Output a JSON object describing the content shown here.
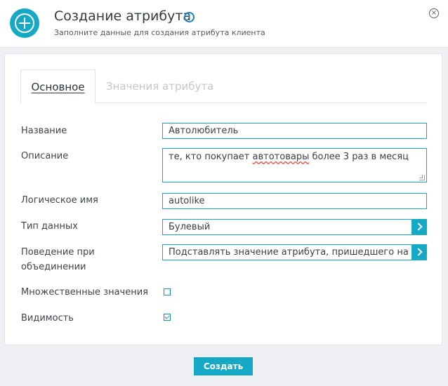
{
  "header": {
    "title": "Создание атрибута",
    "info_icon": "info-icon",
    "info_glyph": "!",
    "subtitle": "Заполните данные для создания атрибута клиента",
    "close_glyph": "×"
  },
  "tabs": [
    {
      "label": "Основное",
      "active": true
    },
    {
      "label": "Значения атрибута",
      "active": false
    }
  ],
  "form": {
    "name": {
      "label": "Название",
      "value": "Автолюбитель"
    },
    "description": {
      "label": "Описание",
      "value_before": "те, кто покупает ",
      "value_misspelled": "автотовары",
      "value_after": " более 3 раз в месяц"
    },
    "logical_name": {
      "label": "Логическое имя",
      "value": "autolike"
    },
    "data_type": {
      "label": "Тип данных",
      "value": "Булевый"
    },
    "merge_behavior": {
      "label_line1": "Поведение при",
      "label_line2": "объединении",
      "value": "Подставлять значение атрибута, пришедшего на ..."
    },
    "multiple_values": {
      "label": "Множественные значения",
      "checked": false
    },
    "visibility": {
      "label": "Видимость",
      "checked": true
    }
  },
  "footer": {
    "create_label": "Создать"
  },
  "colors": {
    "accent": "#16a9c5",
    "background": "#eef0f4",
    "checkbox": "#1a8fbf",
    "info": "#1e80c2"
  }
}
